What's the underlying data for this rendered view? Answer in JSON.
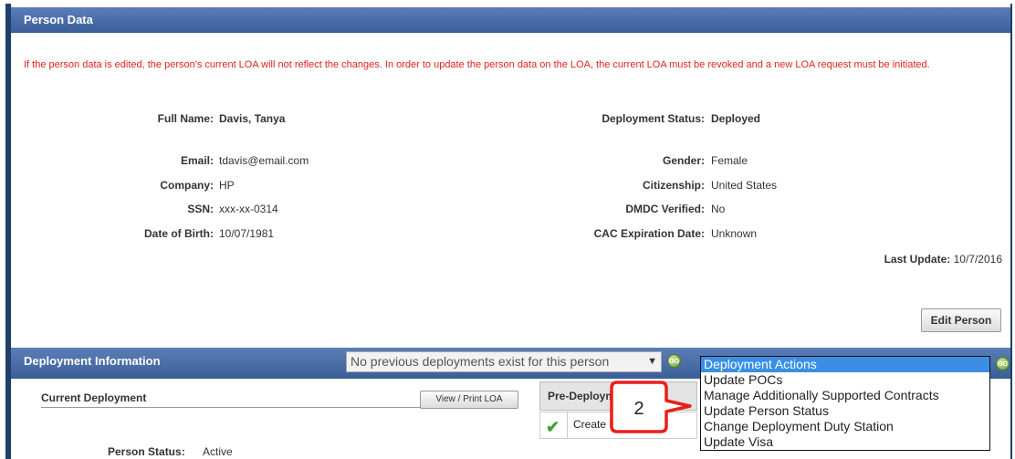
{
  "person_section": {
    "title": "Person Data",
    "warning": "If the person data is edited, the person's current LOA will not reflect the changes. In order to update the person data on the LOA, the current LOA must be revoked and a new LOA request must be initiated.",
    "full_name_label": "Full Name:",
    "full_name": "Davis, Tanya",
    "deployment_status_label": "Deployment Status:",
    "deployment_status": "Deployed",
    "email_label": "Email:",
    "email": "tdavis@email.com",
    "gender_label": "Gender:",
    "gender": "Female",
    "company_label": "Company:",
    "company": "HP",
    "citizenship_label": "Citizenship:",
    "citizenship": "United States",
    "ssn_label": "SSN:",
    "ssn": "xxx-xx-0314",
    "dmdc_label": "DMDC Verified:",
    "dmdc": "No",
    "dob_label": "Date of Birth:",
    "dob": "10/07/1981",
    "cac_label": "CAC Expiration Date:",
    "cac": "Unknown",
    "last_update_label": "Last Update:",
    "last_update": "10/7/2016",
    "edit_button": "Edit Person"
  },
  "deployment_section": {
    "title": "Deployment Information",
    "previous_select": "No previous deployments exist for this person",
    "go_icon_text": "GO",
    "actions_dropdown": {
      "options": [
        "Deployment Actions",
        "Update POCs",
        "Manage Additionally Supported Contracts",
        "Update Person Status",
        "Change Deployment Duty Station",
        "Update Visa"
      ],
      "selected_index": 0
    },
    "callout_number": "2",
    "current_deployment_label": "Current Deployment",
    "view_print_button": "View / Print LOA",
    "pre_deployment_header": "Pre-Deployment",
    "pre_deployment_item": "Create Deployment",
    "person_status_label": "Person Status:",
    "person_status": "Active"
  },
  "colors": {
    "header_blue": "#3a5f98",
    "warning_red": "#e0231c",
    "callout_red": "#e8201a",
    "selected_blue": "#3a8fe5"
  }
}
